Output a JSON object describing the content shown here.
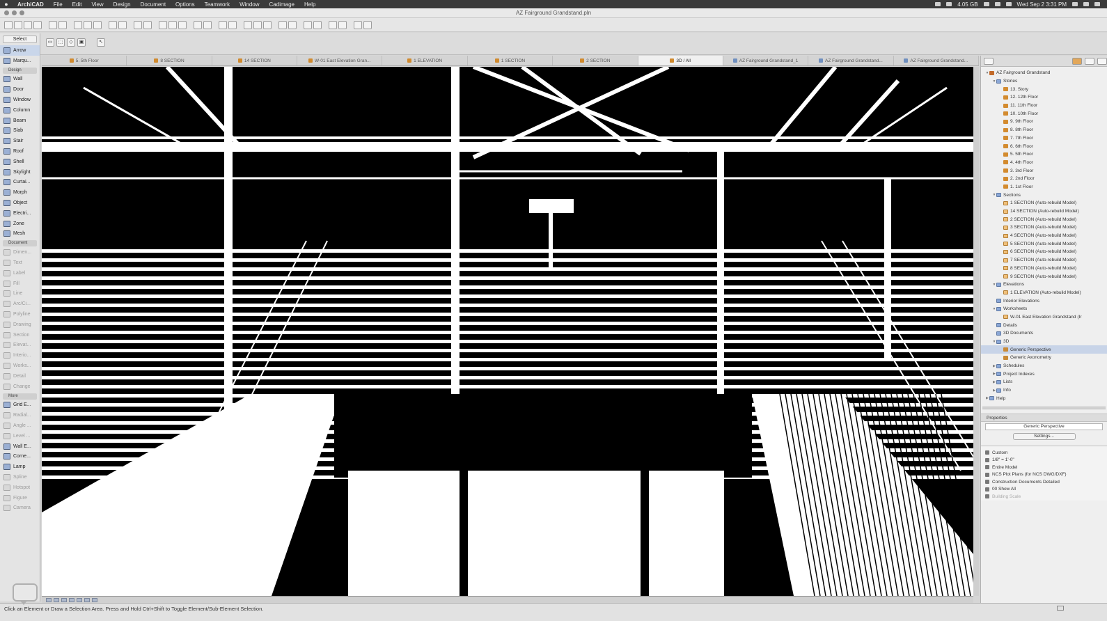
{
  "menubar": {
    "app": "ArchiCAD",
    "items": [
      "File",
      "Edit",
      "View",
      "Design",
      "Document",
      "Options",
      "Teamwork",
      "Window",
      "Cadimage",
      "Help"
    ],
    "storage": "4.05 GB",
    "clock": "Wed Sep 2  3:31 PM"
  },
  "window": {
    "title": "AZ Fairground Grandstand.pln"
  },
  "toolbox": {
    "select_label": "Select",
    "tools_top": [
      {
        "label": "Arrow",
        "sel": true
      },
      {
        "label": "Marqu..."
      }
    ],
    "design_label": "Design",
    "design_tools": [
      "Wall",
      "Door",
      "Window",
      "Column",
      "Beam",
      "Slab",
      "Stair",
      "Roof",
      "Shell",
      "Skylight",
      "Curtai...",
      "Morph",
      "Object",
      "Electri...",
      "Zone",
      "Mesh"
    ],
    "document_label": "Document",
    "document_tools": [
      "Dimen...",
      "Text",
      "Label",
      "Fill",
      "Line",
      "Arc/Ci...",
      "Polyline",
      "Drawing",
      "Section",
      "Elevat...",
      "Interio...",
      "Works...",
      "Detail",
      "Change"
    ],
    "more_label": "More",
    "more_tools": [
      {
        "label": "Grid E...",
        "dim": false
      },
      {
        "label": "Radial...",
        "dim": true
      },
      {
        "label": "Angle ...",
        "dim": true
      },
      {
        "label": "Level ...",
        "dim": true
      },
      {
        "label": "Wall E...",
        "dim": false
      },
      {
        "label": "Corne...",
        "dim": false
      },
      {
        "label": "Lamp",
        "dim": false
      },
      {
        "label": "Spline",
        "dim": true
      },
      {
        "label": "Hotspot",
        "dim": true
      },
      {
        "label": "Figure",
        "dim": true
      },
      {
        "label": "Camera",
        "dim": true
      }
    ]
  },
  "tabs": [
    {
      "label": "5. 5th Floor",
      "icon": "story"
    },
    {
      "label": "8 SECTION",
      "icon": "story"
    },
    {
      "label": "14 SECTION",
      "icon": "story"
    },
    {
      "label": "W-01 East Elevation Gran...",
      "icon": "story"
    },
    {
      "label": "1 ELEVATION",
      "icon": "story"
    },
    {
      "label": "1 SECTION",
      "icon": "story"
    },
    {
      "label": "2 SECTION",
      "icon": "story"
    },
    {
      "label": "3D / All",
      "icon": "story",
      "active": true
    },
    {
      "label": "AZ Fairground Grandstand_1",
      "icon": "blue"
    },
    {
      "label": "AZ Fairground Grandstand...",
      "icon": "blue"
    },
    {
      "label": "AZ Fairground Grandstand...",
      "icon": "blue"
    }
  ],
  "navigator": {
    "tree": [
      {
        "label": "AZ Fairground Grandstand",
        "indent": 0,
        "icon": "proj",
        "tw": "▼"
      },
      {
        "label": "Stories",
        "indent": 1,
        "icon": "folder",
        "tw": "▼"
      },
      {
        "label": "13. Story",
        "indent": 2,
        "icon": "story"
      },
      {
        "label": "12. 12th Floor",
        "indent": 2,
        "icon": "story"
      },
      {
        "label": "11. 11th Floor",
        "indent": 2,
        "icon": "story"
      },
      {
        "label": "10. 10th Floor",
        "indent": 2,
        "icon": "story"
      },
      {
        "label": "9. 9th Floor",
        "indent": 2,
        "icon": "story"
      },
      {
        "label": "8. 8th Floor",
        "indent": 2,
        "icon": "story"
      },
      {
        "label": "7. 7th Floor",
        "indent": 2,
        "icon": "story"
      },
      {
        "label": "6. 6th Floor",
        "indent": 2,
        "icon": "story"
      },
      {
        "label": "5. 5th Floor",
        "indent": 2,
        "icon": "story"
      },
      {
        "label": "4. 4th Floor",
        "indent": 2,
        "icon": "story"
      },
      {
        "label": "3. 3rd Floor",
        "indent": 2,
        "icon": "story"
      },
      {
        "label": "2. 2nd Floor",
        "indent": 2,
        "icon": "story"
      },
      {
        "label": "1. 1st Floor",
        "indent": 2,
        "icon": "story"
      },
      {
        "label": "Sections",
        "indent": 1,
        "icon": "folder",
        "tw": "▼"
      },
      {
        "label": "1 SECTION (Auto-rebuild Model)",
        "indent": 2,
        "icon": "section"
      },
      {
        "label": "14 SECTION (Auto-rebuild Model)",
        "indent": 2,
        "icon": "section"
      },
      {
        "label": "2 SECTION (Auto-rebuild Model)",
        "indent": 2,
        "icon": "section"
      },
      {
        "label": "3 SECTION (Auto-rebuild Model)",
        "indent": 2,
        "icon": "section"
      },
      {
        "label": "4 SECTION (Auto-rebuild Model)",
        "indent": 2,
        "icon": "section"
      },
      {
        "label": "5 SECTION (Auto-rebuild Model)",
        "indent": 2,
        "icon": "section"
      },
      {
        "label": "6 SECTION (Auto-rebuild Model)",
        "indent": 2,
        "icon": "section"
      },
      {
        "label": "7 SECTION (Auto-rebuild Model)",
        "indent": 2,
        "icon": "section"
      },
      {
        "label": "8 SECTION (Auto-rebuild Model)",
        "indent": 2,
        "icon": "section"
      },
      {
        "label": "9 SECTION (Auto-rebuild Model)",
        "indent": 2,
        "icon": "section"
      },
      {
        "label": "Elevations",
        "indent": 1,
        "icon": "folder",
        "tw": "▼"
      },
      {
        "label": "1 ELEVATION (Auto-rebuild Model)",
        "indent": 2,
        "icon": "section"
      },
      {
        "label": "Interior Elevations",
        "indent": 1,
        "icon": "folder"
      },
      {
        "label": "Worksheets",
        "indent": 1,
        "icon": "folder",
        "tw": "▼"
      },
      {
        "label": "W-01 East Elevation Grandstand (Ir",
        "indent": 2,
        "icon": "section"
      },
      {
        "label": "Details",
        "indent": 1,
        "icon": "folder"
      },
      {
        "label": "3D Documents",
        "indent": 1,
        "icon": "folder"
      },
      {
        "label": "3D",
        "indent": 1,
        "icon": "folder",
        "tw": "▼"
      },
      {
        "label": "Generic Perspective",
        "indent": 2,
        "icon": "persp",
        "sel": true
      },
      {
        "label": "Generic Axonometry",
        "indent": 2,
        "icon": "persp"
      },
      {
        "label": "Schedules",
        "indent": 1,
        "icon": "folder",
        "tw": "▶"
      },
      {
        "label": "Project Indexes",
        "indent": 1,
        "icon": "folder",
        "tw": "▶"
      },
      {
        "label": "Lists",
        "indent": 1,
        "icon": "folder",
        "tw": "▶"
      },
      {
        "label": "Info",
        "indent": 1,
        "icon": "folder",
        "tw": "▶"
      },
      {
        "label": "Help",
        "indent": 0,
        "icon": "folder",
        "tw": "▶"
      }
    ],
    "properties_label": "Properties",
    "properties_value": "Generic Perspective",
    "settings_label": "Settings...",
    "publisher": [
      {
        "label": "Custom",
        "dim": false
      },
      {
        "label": "1/8\"    =    1'-0\"",
        "dim": false
      },
      {
        "label": "Entire Model",
        "dim": false
      },
      {
        "label": "NCS Plot Plans (for NCS DWG/DXF)",
        "dim": false
      },
      {
        "label": "Construction Documents Detailed",
        "dim": false
      },
      {
        "label": "00 Show All",
        "dim": false
      },
      {
        "label": "Building Scale",
        "dim": true
      }
    ]
  },
  "status": {
    "message": "Click an Element or Draw a Selection Area. Press and Hold Ctrl+Shift to Toggle Element/Sub-Element Selection."
  }
}
